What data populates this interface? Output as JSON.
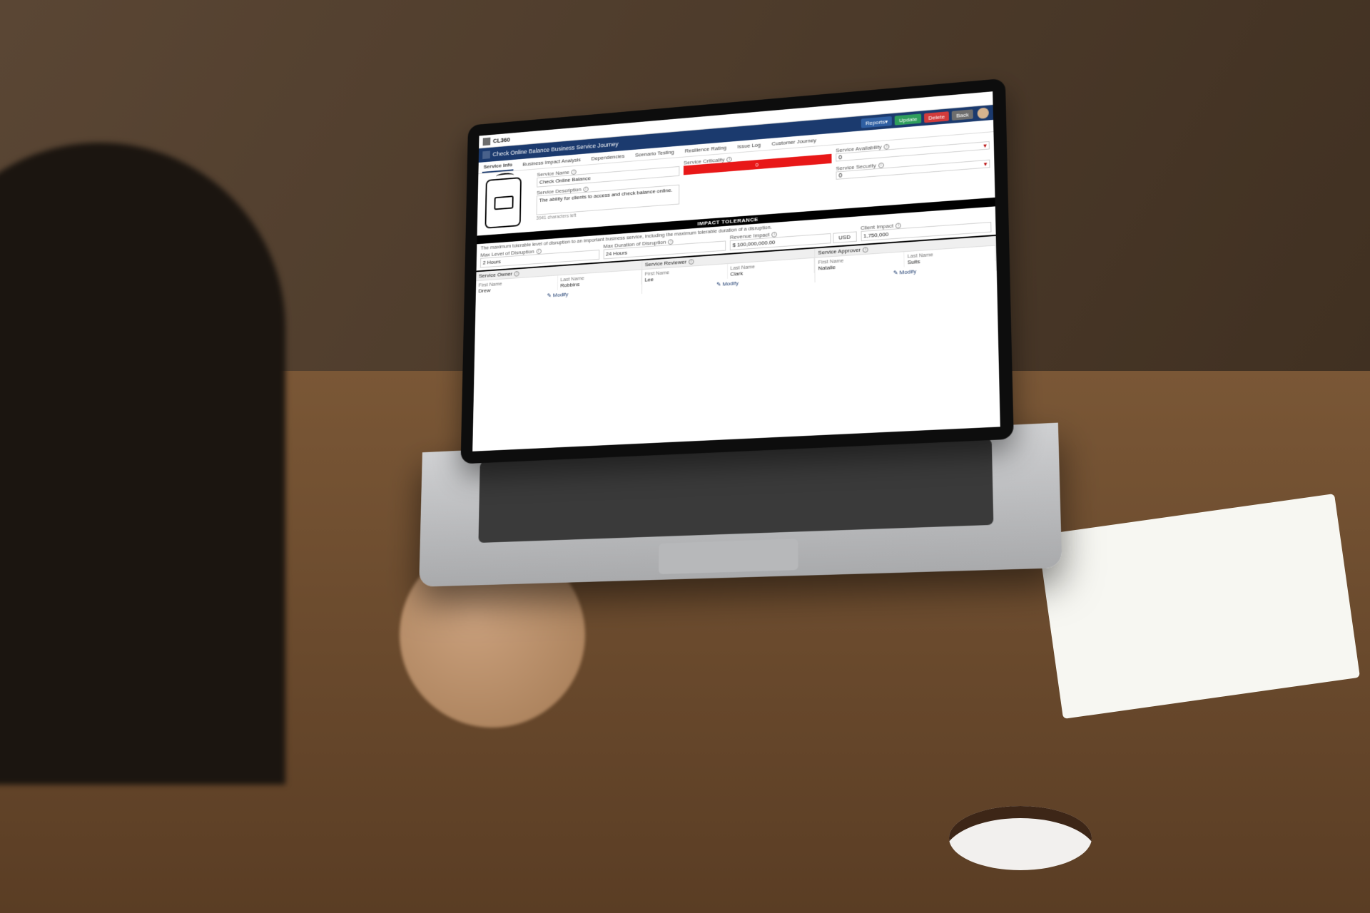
{
  "app": {
    "name": "CL360"
  },
  "page": {
    "title": "Check Online Balance Business Service Journey"
  },
  "toolbar": {
    "reports": "Reports",
    "update": "Update",
    "delete": "Delete",
    "back": "Back"
  },
  "tabs": [
    {
      "label": "Service Info",
      "active": true
    },
    {
      "label": "Business Impact Analysis"
    },
    {
      "label": "Dependencies"
    },
    {
      "label": "Scenario Testing"
    },
    {
      "label": "Resilience Rating"
    },
    {
      "label": "Issue Log"
    },
    {
      "label": "Customer Journey"
    }
  ],
  "service": {
    "name_label": "Service Name",
    "name_value": "Check Online Balance",
    "desc_label": "Service Description",
    "desc_value": "The ability for clients to access and check balance online.",
    "chars_left": "3941 characters left",
    "criticality_label": "Service Criticality",
    "criticality_value": "0",
    "availability_label": "Service Availability",
    "availability_value": "0",
    "security_label": "Service Security",
    "security_value": "0"
  },
  "impact": {
    "band": "IMPACT TOLERANCE",
    "hint": "The maximum tolerable level of disruption to an important business service, including the maximum tolerable duration of a disruption.",
    "max_level_label": "Max Level of Disruption",
    "max_level_value": "2 Hours",
    "max_duration_label": "Max Duration of Disruption",
    "max_duration_value": "24 Hours",
    "revenue_label": "Revenue Impact",
    "revenue_value": "$   100,000,000.00",
    "revenue_ccy": "USD",
    "client_label": "Client Impact",
    "client_value": "1,750,000"
  },
  "people": {
    "owner_label": "Service Owner",
    "reviewer_label": "Service Reviewer",
    "approver_label": "Service Approver",
    "first_name": "First Name",
    "last_name": "Last Name",
    "modify": "Modify",
    "owner": {
      "first": "Drew",
      "last": "Robbins"
    },
    "reviewer": {
      "first": "Lee",
      "last": "Clark"
    },
    "approver": {
      "first": "Natalie",
      "last": "Suits"
    }
  }
}
